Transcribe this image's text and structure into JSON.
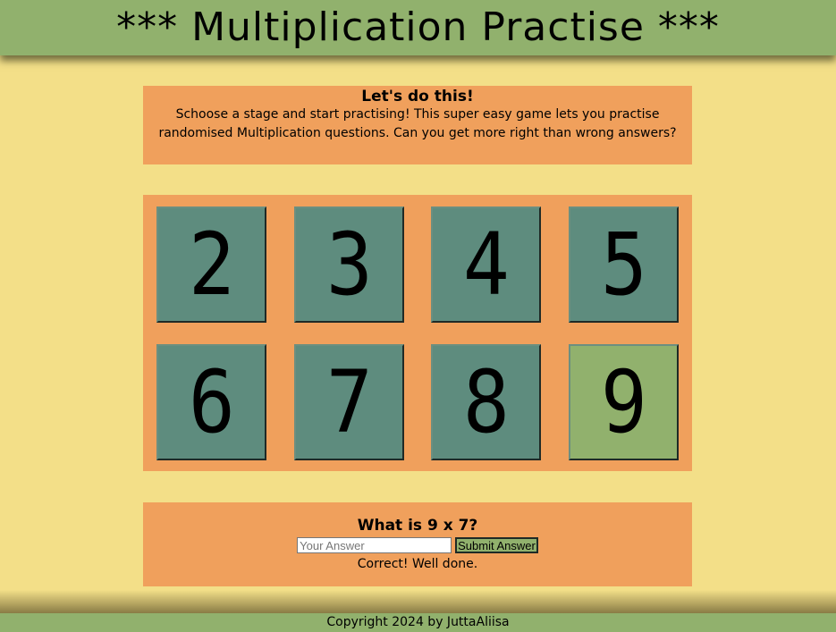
{
  "header": {
    "title": "*** Multiplication Practise ***"
  },
  "intro": {
    "heading": "Let's do this!",
    "text": "Schoose a stage and start practising! This super easy game lets you practise randomised Multiplication questions. Can you get more right than wrong answers?"
  },
  "stages": [
    {
      "label": "2",
      "active": false
    },
    {
      "label": "3",
      "active": false
    },
    {
      "label": "4",
      "active": false
    },
    {
      "label": "5",
      "active": false
    },
    {
      "label": "6",
      "active": false
    },
    {
      "label": "7",
      "active": false
    },
    {
      "label": "8",
      "active": false
    },
    {
      "label": "9",
      "active": true
    }
  ],
  "quiz": {
    "question": "What is 9 x 7?",
    "answer_value": "",
    "answer_placeholder": "Your Answer",
    "submit_label": "Submit Answer",
    "feedback": "Correct! Well done."
  },
  "footer": {
    "copyright": "Copyright 2024 by JuttaAliisa"
  },
  "colors": {
    "background": "#f3df88",
    "bar": "#91b16d",
    "panel": "#f0a05c",
    "tile": "#5e8c7e",
    "tile_active": "#91b16d"
  }
}
